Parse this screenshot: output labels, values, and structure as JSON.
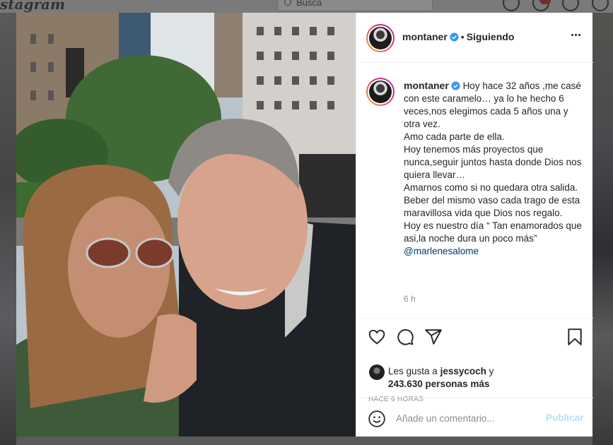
{
  "background": {
    "logo": "stagram",
    "search_placeholder": "Busca"
  },
  "post": {
    "author": "montaner",
    "follow_status": "Siguiendo",
    "separator": "•",
    "caption_username": "montaner",
    "caption": "Hoy hace 32 años ,me casé con este caramelo… ya lo he hecho 6 veces,nos elegimos cada 5 años una y otra vez.\nAmo cada parte de ella.\nHoy tenemos más proyectos que nunca,seguir juntos hasta donde Dios nos quiera llevar…\nAmarnos como si no quedara otra salida.\nBeber del mismo vaso cada trago de esta maravillosa vida que Dios nos regalo.\nHoy es nuestro día “ Tan enamorados que asi,la noche dura un poco más”",
    "mention": "@marlenesalome",
    "time_ago": "6 h",
    "likes": {
      "prefix": "Les gusta a",
      "first_user": "jessycoch",
      "connector": "y",
      "count_text": "243.630 personas más"
    },
    "posted_age": "HACE 6 HORAS"
  },
  "comment": {
    "placeholder": "Añade un comentario...",
    "publish_label": "Publicar"
  },
  "icons": {
    "header": [
      "more-options-icon",
      "verified-badge-icon"
    ],
    "actions": [
      "heart-icon",
      "comment-icon",
      "share-icon",
      "bookmark-icon"
    ],
    "comment": [
      "emoji-icon"
    ]
  },
  "colors": {
    "verified": "#3897f0",
    "mention": "#00376b",
    "publish_disabled": "#b2dffc",
    "muted_text": "#8e8e8e"
  }
}
